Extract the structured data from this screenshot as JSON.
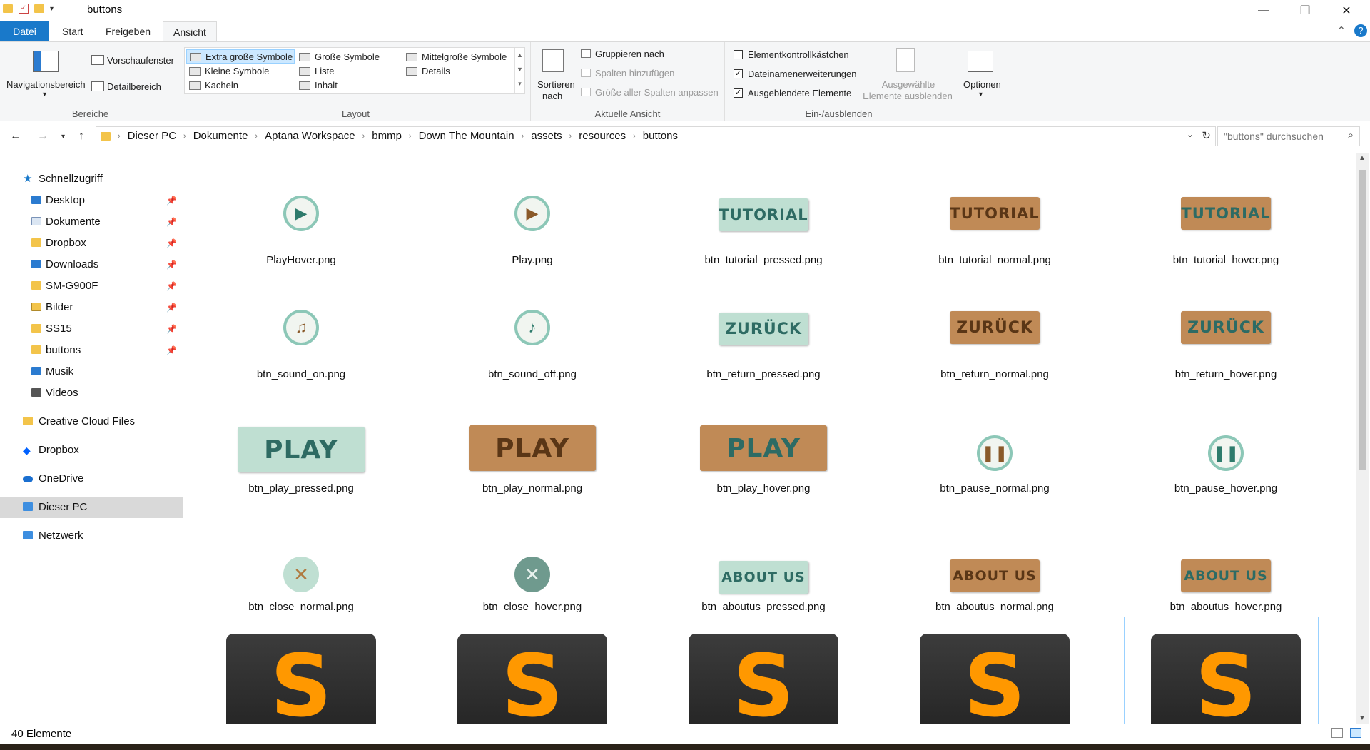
{
  "window": {
    "title": "buttons"
  },
  "tabs": [
    "Datei",
    "Start",
    "Freigeben",
    "Ansicht"
  ],
  "ribbon": {
    "bereiche": {
      "nav": "Navigationsbereich",
      "preview": "Vorschaufenster",
      "details": "Detailbereich",
      "label": "Bereiche"
    },
    "layout": {
      "items": [
        "Extra große Symbole",
        "Große Symbole",
        "Mittelgroße Symbole",
        "Kleine Symbole",
        "Liste",
        "Details",
        "Kacheln",
        "Inhalt"
      ],
      "label": "Layout"
    },
    "view": {
      "sort1": "Sortieren",
      "sort2": "nach",
      "group": "Gruppieren nach",
      "addcols": "Spalten hinzufügen",
      "fitcols": "Größe aller Spalten anpassen",
      "label": "Aktuelle Ansicht"
    },
    "showhide": {
      "checkboxes": "Elementkontrollkästchen",
      "extensions": "Dateinamenerweiterungen",
      "hidden": "Ausgeblendete Elemente",
      "hide1": "Ausgewählte",
      "hide2": "Elemente ausblenden",
      "label": "Ein-/ausblenden"
    },
    "options": "Optionen"
  },
  "address": {
    "crumbs": [
      "Dieser PC",
      "Dokumente",
      "Aptana Workspace",
      "bmmp",
      "Down The Mountain",
      "assets",
      "resources",
      "buttons"
    ],
    "search_placeholder": "\"buttons\" durchsuchen"
  },
  "sidebar": {
    "quick": "Schnellzugriff",
    "items": [
      "Desktop",
      "Dokumente",
      "Dropbox",
      "Downloads",
      "SM-G900F",
      "Bilder",
      "SS15",
      "buttons",
      "Musik",
      "Videos"
    ],
    "creative": "Creative Cloud Files",
    "dropbox": "Dropbox",
    "onedrive": "OneDrive",
    "thispc": "Dieser PC",
    "network": "Netzwerk"
  },
  "files": {
    "row1": [
      "PlayHover.png",
      "Play.png",
      "btn_tutorial_pressed.png",
      "btn_tutorial_normal.png",
      "btn_tutorial_hover.png"
    ],
    "row2": [
      "btn_sound_on.png",
      "btn_sound_off.png",
      "btn_return_pressed.png",
      "btn_return_normal.png",
      "btn_return_hover.png"
    ],
    "row3": [
      "btn_play_pressed.png",
      "btn_play_normal.png",
      "btn_play_hover.png",
      "btn_pause_normal.png",
      "btn_pause_hover.png"
    ],
    "row4": [
      "btn_close_normal.png",
      "btn_close_hover.png",
      "btn_aboutus_pressed.png",
      "btn_aboutus_normal.png",
      "btn_aboutus_hover.png"
    ]
  },
  "signs": {
    "tutorial": "TUTORIAL",
    "return": "ZURÜCK",
    "play": "PLAY",
    "about": "ABOUT US"
  },
  "status": {
    "count": "40 Elemente"
  }
}
